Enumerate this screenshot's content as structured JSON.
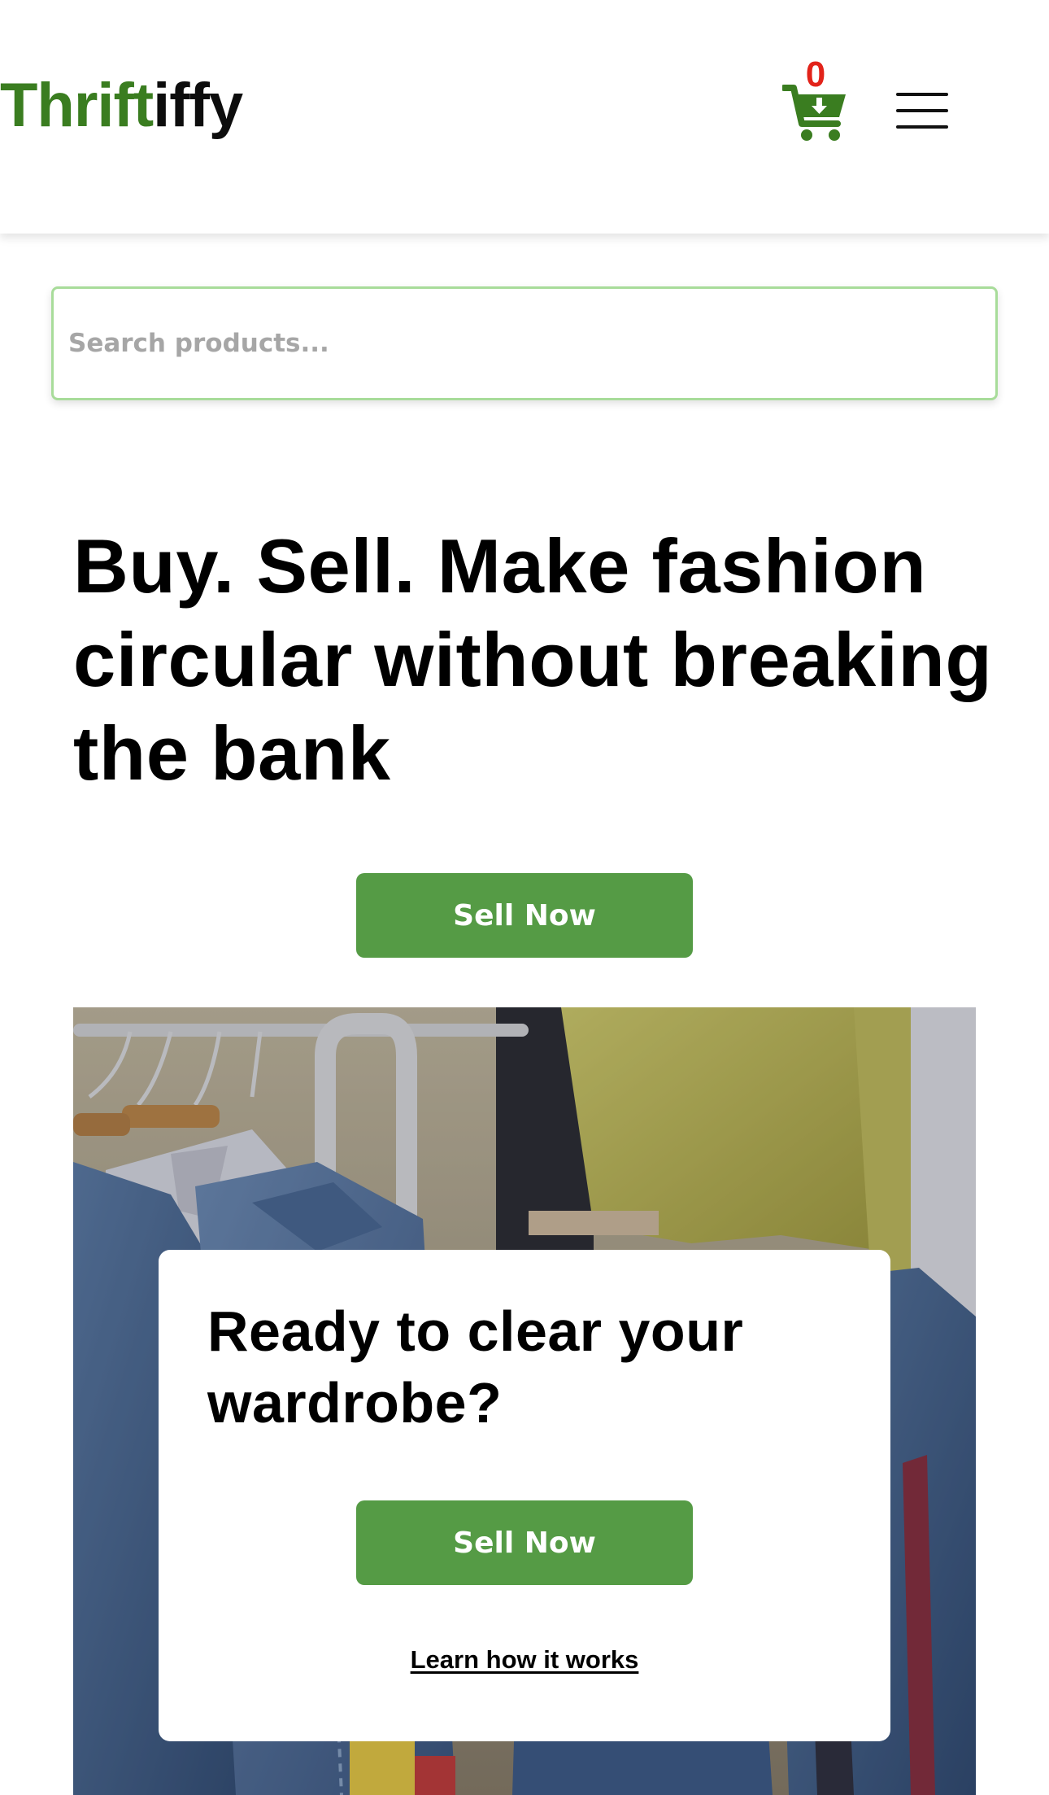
{
  "header": {
    "logo_part1": "Thrift",
    "logo_part2": "iffy",
    "cart_count": "0",
    "cart_icon": "cart-download-icon",
    "menu_icon": "hamburger-menu-icon"
  },
  "search": {
    "placeholder": "Search products..."
  },
  "hero": {
    "title": "Buy. Sell. Make fashion circular without breaking the bank",
    "sell_button": "Sell Now"
  },
  "banner": {
    "card_title": "Ready to clear your wardrobe?",
    "sell_button": "Sell Now",
    "learn_link": "Learn how it works"
  },
  "colors": {
    "brand_green": "#3a7d20",
    "button_green": "#559b45",
    "cart_badge": "#e2231a",
    "search_border": "#a8dc9a"
  }
}
